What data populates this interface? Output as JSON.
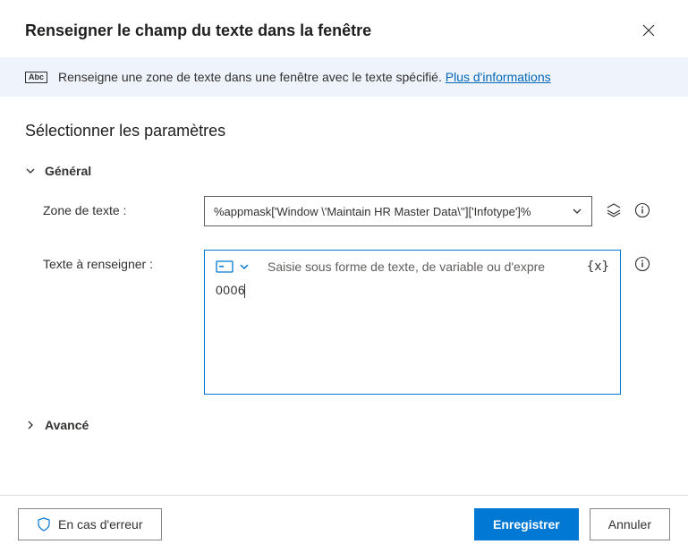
{
  "header": {
    "title": "Renseigner le champ du texte dans la fenêtre"
  },
  "banner": {
    "text": "Renseigne une zone de texte dans une fenêtre avec le texte spécifié.",
    "link": "Plus d'informations"
  },
  "section": {
    "title": "Sélectionner les paramètres",
    "general": "Général",
    "advanced": "Avancé"
  },
  "params": {
    "textbox_label": "Zone de texte :",
    "textbox_value": "%appmask['Window \\'Maintain HR Master Data\\'']['Infotype']%",
    "fill_label": "Texte à renseigner :",
    "fill_placeholder": "Saisie sous forme de texte, de variable ou d'expre",
    "fill_value": "0006"
  },
  "footer": {
    "error": "En cas d'erreur",
    "save": "Enregistrer",
    "cancel": "Annuler"
  }
}
